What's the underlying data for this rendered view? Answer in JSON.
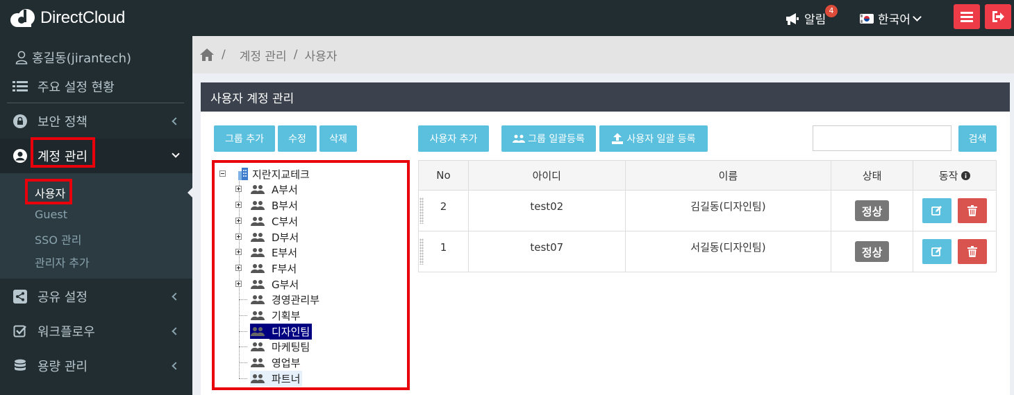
{
  "brand": {
    "name": "DirectCloud"
  },
  "header": {
    "notifications_label": "알림",
    "notifications_count": "4",
    "language": "한국어"
  },
  "sidebar": {
    "user": "홍길동(jirantech)",
    "items": [
      {
        "label": "주요 설정 현황"
      },
      {
        "label": "보안 정책"
      },
      {
        "label": "계정 관리"
      },
      {
        "label": "공유 설정"
      },
      {
        "label": "워크플로우"
      },
      {
        "label": "용량 관리"
      }
    ],
    "submenu": [
      {
        "label": "사용자"
      },
      {
        "label": "Guest"
      },
      {
        "label": "SSO 관리"
      },
      {
        "label": "관리자 추가"
      }
    ]
  },
  "breadcrumb": {
    "level1": "계정 관리",
    "level2": "사용자",
    "sep": "/"
  },
  "panel": {
    "title": "사용자 계정 관리",
    "buttons": {
      "add_group": "그룹 추가",
      "edit": "수정",
      "delete": "삭제",
      "add_user": "사용자 추가",
      "group_bulk": "그룹 일괄등록",
      "user_bulk": "사용자 일괄 등록",
      "search": "검색"
    },
    "search_value": ""
  },
  "tree": {
    "root": "지란지교테크",
    "nodes": [
      "A부서",
      "B부서",
      "C부서",
      "D부서",
      "E부서",
      "F부서",
      "G부서",
      "경영관리부",
      "기획부",
      "디자인팀",
      "마케팅팀",
      "영업부",
      "파트너"
    ],
    "selected": "디자인팀"
  },
  "table": {
    "headers": [
      "No",
      "아이디",
      "이름",
      "상태",
      "동작"
    ],
    "rows": [
      {
        "no": "2",
        "id": "test02",
        "name": "김길동(디자인팀)",
        "status": "정상"
      },
      {
        "no": "1",
        "id": "test07",
        "name": "서길동(디자인팀)",
        "status": "정상"
      }
    ]
  },
  "colors": {
    "header_bg": "#222d32",
    "accent_red": "#ee3b48",
    "info_btn": "#5bc0de",
    "danger_btn": "#d9534f",
    "highlight": "#e8000b"
  }
}
